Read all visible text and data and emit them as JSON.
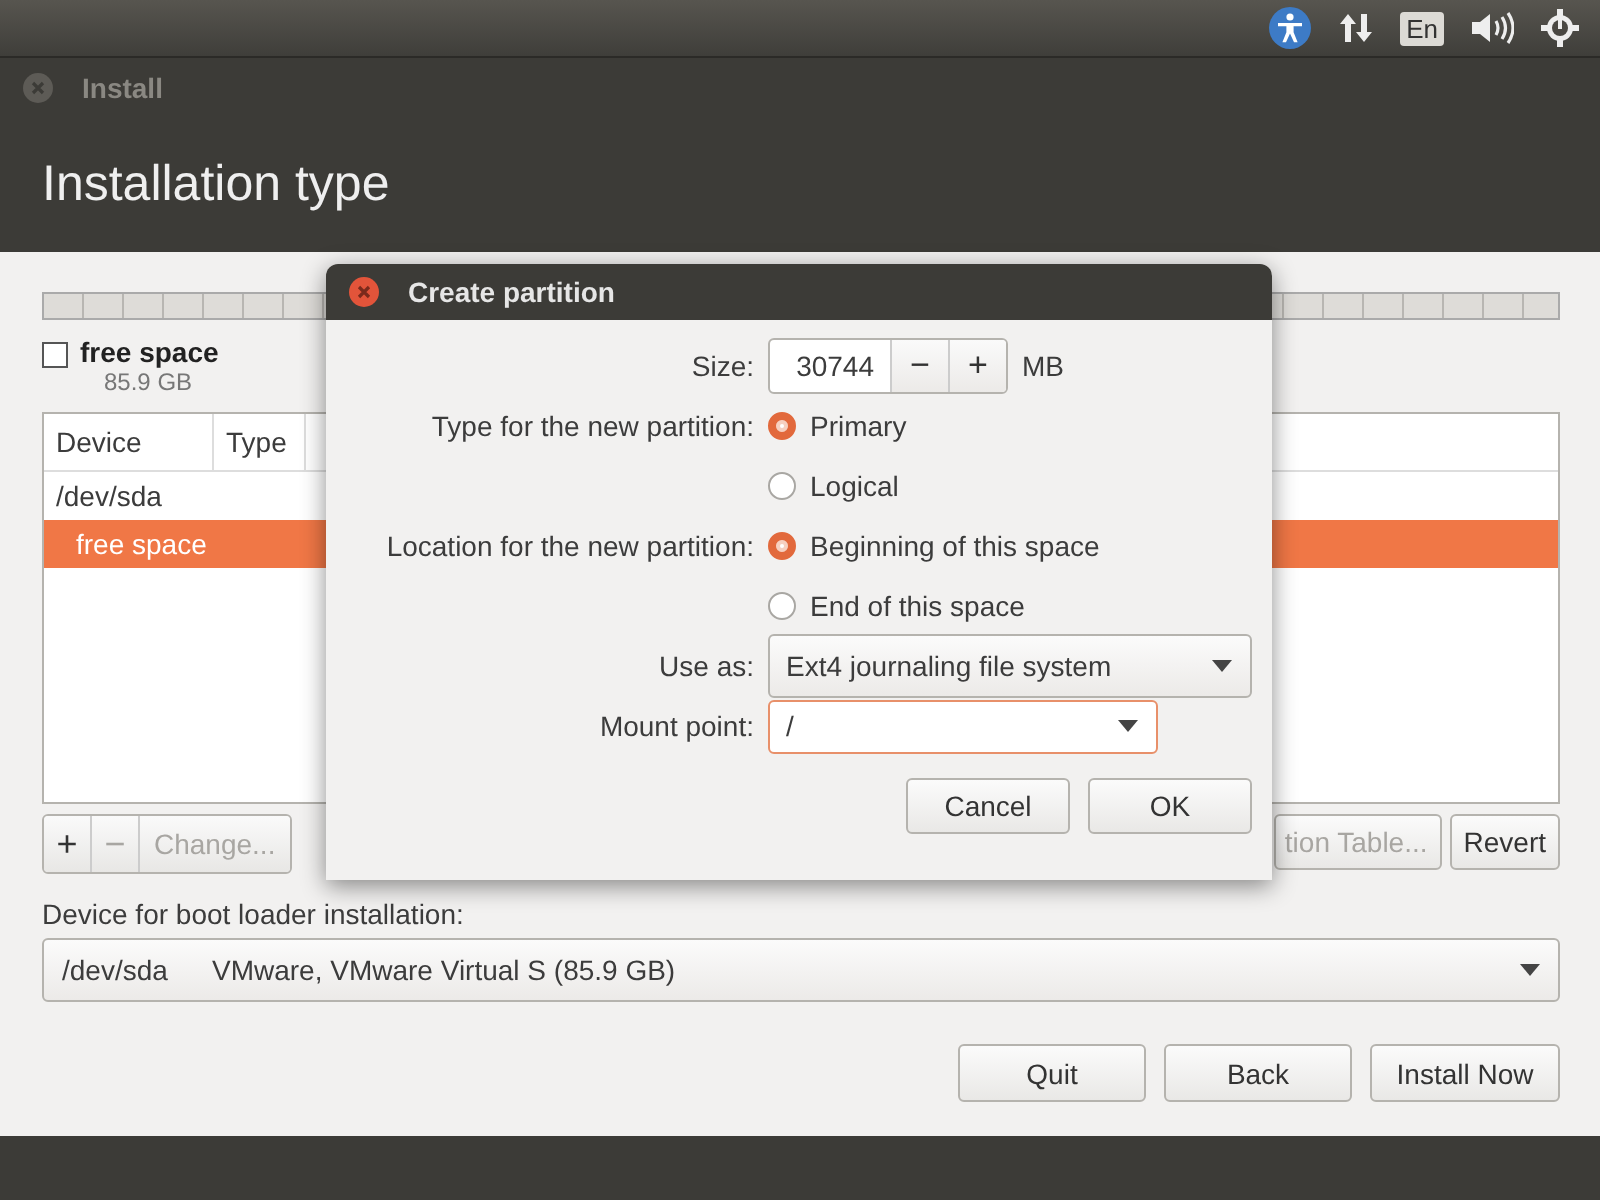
{
  "top_panel": {
    "keyboard_layout": "En"
  },
  "window": {
    "title": "Install"
  },
  "page": {
    "heading": "Installation type"
  },
  "legend": {
    "label": "free space",
    "size": "85.9 GB"
  },
  "partitions": {
    "columns": [
      "Device",
      "Type"
    ],
    "rows": [
      {
        "device": "/dev/sda",
        "selected": false,
        "children": [
          {
            "device": "free space",
            "selected": true
          }
        ]
      }
    ]
  },
  "partition_buttons": [
    {
      "label": "+",
      "disabled": false
    },
    {
      "label": "−",
      "disabled": true
    },
    {
      "label": "Change...",
      "disabled": true
    }
  ],
  "table_buttons": [
    {
      "label": "tion Table...",
      "disabled": true
    },
    {
      "label": "Revert",
      "disabled": false
    }
  ],
  "boot_loader": {
    "label": "Device for boot loader installation:",
    "device": "/dev/sda",
    "description": "VMware, VMware Virtual S (85.9 GB)"
  },
  "buttons": [
    "Quit",
    "Back",
    "Install Now"
  ],
  "dialog": {
    "title": "Create partition",
    "size_label": "Size:",
    "size_value": "30744",
    "decrement": "−",
    "increment": "+",
    "size_unit": "MB",
    "type_label": "Type for the new partition:",
    "type_options": [
      {
        "label": "Primary",
        "selected": true
      },
      {
        "label": "Logical",
        "selected": false
      }
    ],
    "location_label": "Location for the new partition:",
    "location_options": [
      {
        "label": "Beginning of this space",
        "selected": true
      },
      {
        "label": "End of this space",
        "selected": false
      }
    ],
    "use_as_label": "Use as:",
    "use_as_value": "Ext4 journaling file system",
    "mount_label": "Mount point:",
    "mount_value": "/",
    "buttons": [
      "Cancel",
      "OK"
    ]
  }
}
